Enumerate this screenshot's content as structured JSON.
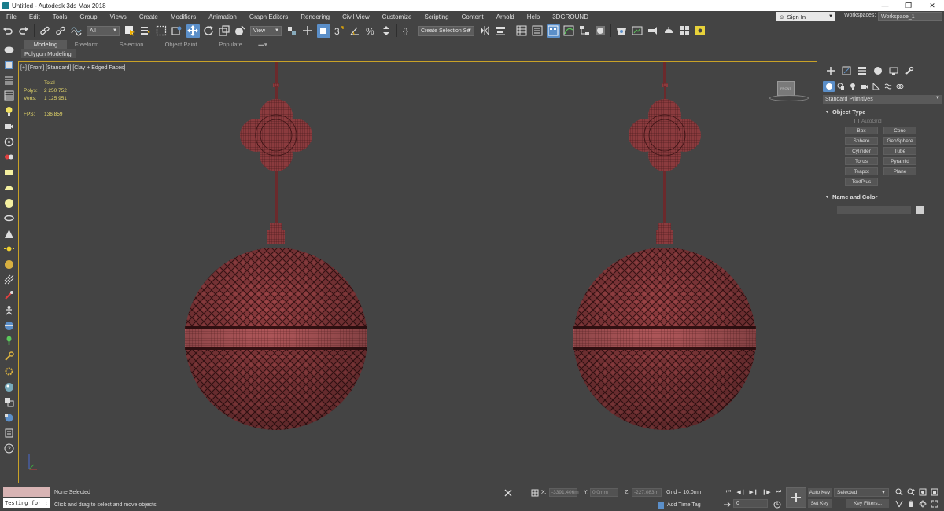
{
  "window": {
    "title": "Untitled - Autodesk 3ds Max 2018",
    "minimize": "—",
    "maximize": "❐",
    "close": "✕"
  },
  "menu": {
    "items": [
      "File",
      "Edit",
      "Tools",
      "Group",
      "Views",
      "Create",
      "Modifiers",
      "Animation",
      "Graph Editors",
      "Rendering",
      "Civil View",
      "Customize",
      "Scripting",
      "Content",
      "Arnold",
      "Help",
      "3DGROUND"
    ],
    "sign_in": "Sign In",
    "workspaces_label": "Workspaces:",
    "workspace_value": "Workspace_1"
  },
  "toolbar": {
    "filter_select": "All",
    "ref_coord_select": "View",
    "selection_set": "Create Selection Se"
  },
  "ribbon": {
    "tabs": [
      "Modeling",
      "Freeform",
      "Selection",
      "Object Paint",
      "Populate"
    ],
    "active_tab": "Modeling",
    "subtab": "Polygon Modeling"
  },
  "viewport": {
    "label": "[+] [Front] [Standard] [Clay + Edged Faces]",
    "stats": {
      "header": "Total",
      "polys_label": "Polys:",
      "polys_value": "2 250 752",
      "verts_label": "Verts:",
      "verts_value": "1 125 951",
      "fps_label": "FPS:",
      "fps_value": "136,859"
    },
    "viewcube_label": "FRONT",
    "colors": {
      "mesh_fill": "#8b3b3e",
      "wire": "#3a1214",
      "frame": "#c9a227"
    }
  },
  "command_panel": {
    "category_select": "Standard Primitives",
    "object_type_title": "Object Type",
    "autogrid": "AutoGrid",
    "buttons": [
      "Box",
      "Cone",
      "Sphere",
      "GeoSphere",
      "Cylinder",
      "Tube",
      "Torus",
      "Pyramid",
      "Teapot",
      "Plane",
      "TextPlus"
    ],
    "name_color_title": "Name and Color"
  },
  "status": {
    "maxscript_input": "Testing for :",
    "selection_status": "None Selected",
    "prompt": "Click and drag to select and move objects",
    "x_label": "X:",
    "x_value": "-3391,406m",
    "y_label": "Y:",
    "y_value": "0,0mm",
    "z_label": "Z:",
    "z_value": "-227,083m",
    "grid": "Grid = 10,0mm",
    "add_time_tag": "Add Time Tag",
    "frame": "0",
    "auto_key": "Auto Key",
    "set_key": "Set Key",
    "selected_dropdown": "Selected",
    "key_filters": "Key Filters..."
  }
}
